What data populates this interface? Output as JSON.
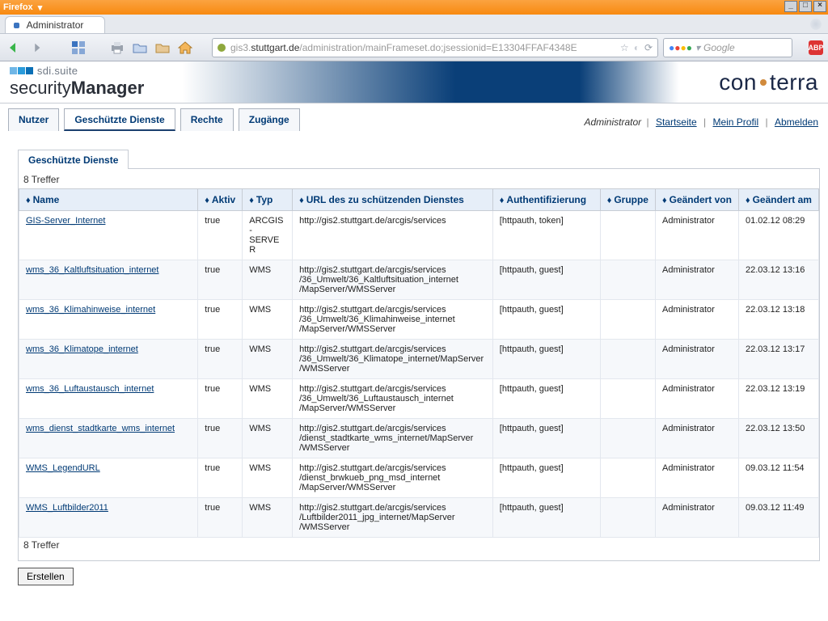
{
  "browser": {
    "title": "Firefox",
    "tab_label": "Administrator",
    "url_host": "stuttgart.de",
    "url_prefix": "gis3.",
    "url_suffix": "/administration/mainFrameset.do;jsessionid=E13304FFAF4348E",
    "search_placeholder": "Google",
    "abp": "ABP"
  },
  "banner": {
    "sdi": "sdi.suite",
    "product_left": "security",
    "product_right": "Manager",
    "brand_left": "con",
    "brand_right": "terra"
  },
  "tabs": {
    "nutzer": "Nutzer",
    "dienste": "Geschützte Dienste",
    "rechte": "Rechte",
    "zugaenge": "Zugänge"
  },
  "userbar": {
    "role": "Administrator",
    "start": "Startseite",
    "profil": "Mein Profil",
    "abmelden": "Abmelden"
  },
  "section": {
    "title": "Geschützte Dienste",
    "count": "8 Treffer",
    "erstellen": "Erstellen"
  },
  "cols": {
    "name": "Name",
    "aktiv": "Aktiv",
    "typ": "Typ",
    "url": "URL des zu schützenden Dienstes",
    "auth": "Authentifizierung",
    "gruppe": "Gruppe",
    "gvon": "Geändert von",
    "gam": "Geändert am"
  },
  "rows": [
    {
      "name": "GIS-Server_Internet",
      "aktiv": "true",
      "typ": "ARCGIS-SERVER",
      "url": "http://gis2.stuttgart.de/arcgis/services",
      "auth": "[httpauth, token]",
      "gruppe": "",
      "gvon": "Administrator",
      "gam": "01.02.12 08:29"
    },
    {
      "name": "wms_36_Kaltluftsituation_internet",
      "aktiv": "true",
      "typ": "WMS",
      "url": "http://gis2.stuttgart.de/arcgis/services/36_Umwelt/36_Kaltluftsituation_internet/MapServer/WMSServer",
      "auth": "[httpauth, guest]",
      "gruppe": "",
      "gvon": "Administrator",
      "gam": "22.03.12 13:16"
    },
    {
      "name": "wms_36_Klimahinweise_internet",
      "aktiv": "true",
      "typ": "WMS",
      "url": "http://gis2.stuttgart.de/arcgis/services/36_Umwelt/36_Klimahinweise_internet/MapServer/WMSServer",
      "auth": "[httpauth, guest]",
      "gruppe": "",
      "gvon": "Administrator",
      "gam": "22.03.12 13:18"
    },
    {
      "name": "wms_36_Klimatope_internet",
      "aktiv": "true",
      "typ": "WMS",
      "url": "http://gis2.stuttgart.de/arcgis/services/36_Umwelt/36_Klimatope_internet/MapServer/WMSServer",
      "auth": "[httpauth, guest]",
      "gruppe": "",
      "gvon": "Administrator",
      "gam": "22.03.12 13:17"
    },
    {
      "name": "wms_36_Luftaustausch_internet",
      "aktiv": "true",
      "typ": "WMS",
      "url": "http://gis2.stuttgart.de/arcgis/services/36_Umwelt/36_Luftaustausch_internet/MapServer/WMSServer",
      "auth": "[httpauth, guest]",
      "gruppe": "",
      "gvon": "Administrator",
      "gam": "22.03.12 13:19"
    },
    {
      "name": "wms_dienst_stadtkarte_wms_internet",
      "aktiv": "true",
      "typ": "WMS",
      "url": "http://gis2.stuttgart.de/arcgis/services/dienst_stadtkarte_wms_internet/MapServer/WMSServer",
      "auth": "[httpauth, guest]",
      "gruppe": "",
      "gvon": "Administrator",
      "gam": "22.03.12 13:50"
    },
    {
      "name": "WMS_LegendURL",
      "aktiv": "true",
      "typ": "WMS",
      "url": "http://gis2.stuttgart.de/arcgis/services/dienst_brwkueb_png_msd_internet/MapServer/WMSServer",
      "auth": "[httpauth, guest]",
      "gruppe": "",
      "gvon": "Administrator",
      "gam": "09.03.12 11:54"
    },
    {
      "name": "WMS_Luftbilder2011",
      "aktiv": "true",
      "typ": "WMS",
      "url": "http://gis2.stuttgart.de/arcgis/services/Luftbilder2011_jpg_internet/MapServer/WMSServer",
      "auth": "[httpauth, guest]",
      "gruppe": "",
      "gvon": "Administrator",
      "gam": "09.03.12 11:49"
    }
  ]
}
